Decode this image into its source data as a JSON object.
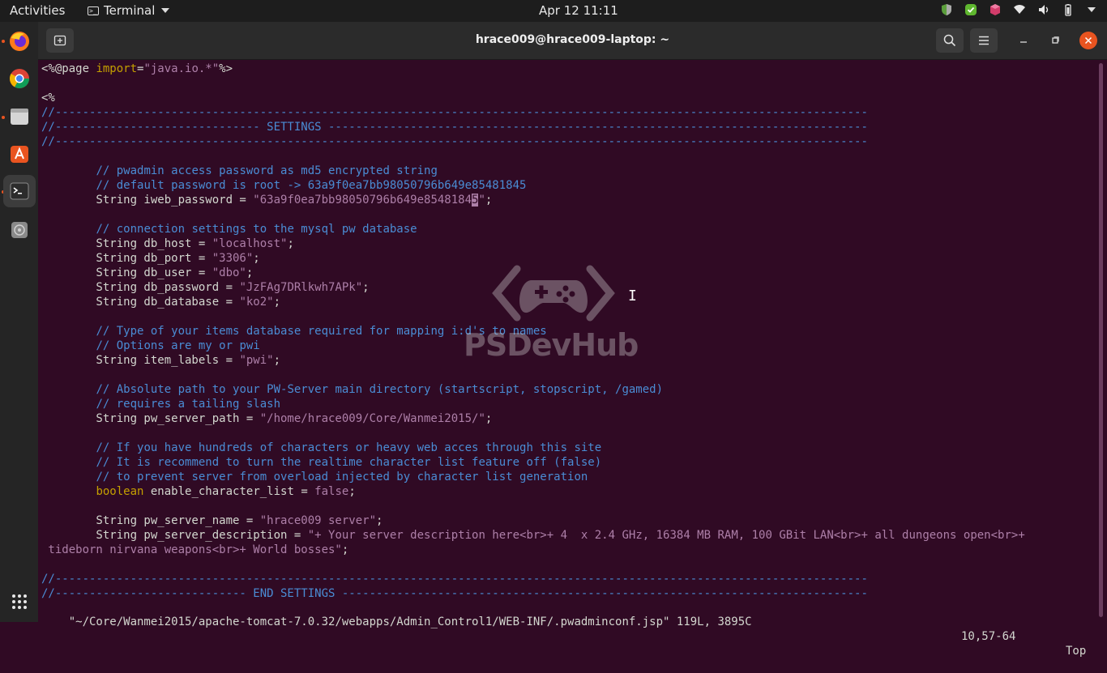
{
  "topbar": {
    "activities": "Activities",
    "app_name": "Terminal",
    "clock": "Apr 12  11:11"
  },
  "dock": {
    "items": [
      "firefox-icon",
      "chrome-icon",
      "files-icon",
      "software-icon",
      "terminal-icon",
      "disc-icon"
    ],
    "show_apps": "app-grid-icon"
  },
  "window": {
    "title": "hrace009@hrace009-laptop: ~"
  },
  "watermark": {
    "text": "PSDevHub"
  },
  "statusline": {
    "file": "\"~/Core/Wanmei2015/apache-tomcat-7.0.32/webapps/Admin_Control1/WEB-INF/.pwadminconf.jsp\" 119L, 3895C",
    "position": "10,57-64",
    "scroll": "Top"
  },
  "terminal": {
    "lines": [
      [
        [
          "t",
          "<%@page "
        ],
        [
          "k",
          "import"
        ],
        [
          "t",
          "="
        ],
        [
          "s",
          "\"java.io.*\""
        ],
        [
          "t",
          "%>"
        ]
      ],
      [],
      [
        [
          "t",
          "<%"
        ]
      ],
      [
        [
          "c",
          "//-----------------------------------------------------------------------------------------------------------------------"
        ]
      ],
      [
        [
          "c",
          "//------------------------------ SETTINGS -------------------------------------------------------------------------------"
        ]
      ],
      [
        [
          "c",
          "//-----------------------------------------------------------------------------------------------------------------------"
        ]
      ],
      [],
      [
        [
          "t",
          "        "
        ],
        [
          "c",
          "// pwadmin access password as md5 encrypted string"
        ]
      ],
      [
        [
          "t",
          "        "
        ],
        [
          "c",
          "// default password is root -> 63a9f0ea7bb98050796b649e85481845"
        ]
      ],
      [
        [
          "t",
          "        String iweb_password = "
        ],
        [
          "s",
          "\"63a9f0ea7bb98050796b649e8548184"
        ],
        [
          "cursor",
          "5"
        ],
        [
          "s",
          "\""
        ],
        [
          "t",
          ";"
        ]
      ],
      [],
      [
        [
          "t",
          "        "
        ],
        [
          "c",
          "// connection settings to the mysql pw database"
        ]
      ],
      [
        [
          "t",
          "        String db_host = "
        ],
        [
          "s",
          "\"localhost\""
        ],
        [
          "t",
          ";"
        ]
      ],
      [
        [
          "t",
          "        String db_port = "
        ],
        [
          "s",
          "\"3306\""
        ],
        [
          "t",
          ";"
        ]
      ],
      [
        [
          "t",
          "        String db_user = "
        ],
        [
          "s",
          "\"dbo\""
        ],
        [
          "t",
          ";"
        ]
      ],
      [
        [
          "t",
          "        String db_password = "
        ],
        [
          "s",
          "\"JzFAg7DRlkwh7APk\""
        ],
        [
          "t",
          ";"
        ]
      ],
      [
        [
          "t",
          "        String db_database = "
        ],
        [
          "s",
          "\"ko2\""
        ],
        [
          "t",
          ";"
        ]
      ],
      [],
      [
        [
          "t",
          "        "
        ],
        [
          "c",
          "// Type of your items database required for mapping i:d's to names"
        ]
      ],
      [
        [
          "t",
          "        "
        ],
        [
          "c",
          "// Options are my or pwi"
        ]
      ],
      [
        [
          "t",
          "        String item_labels = "
        ],
        [
          "s",
          "\"pwi\""
        ],
        [
          "t",
          ";"
        ]
      ],
      [],
      [
        [
          "t",
          "        "
        ],
        [
          "c",
          "// Absolute path to your PW-Server main directory (startscript, stopscript, /gamed)"
        ]
      ],
      [
        [
          "t",
          "        "
        ],
        [
          "c",
          "// requires a tailing slash"
        ]
      ],
      [
        [
          "t",
          "        String pw_server_path = "
        ],
        [
          "s",
          "\"/home/hrace009/Core/Wanmei2015/\""
        ],
        [
          "t",
          ";"
        ]
      ],
      [],
      [
        [
          "t",
          "        "
        ],
        [
          "c",
          "// If you have hundreds of characters or heavy web acces through this site"
        ]
      ],
      [
        [
          "t",
          "        "
        ],
        [
          "c",
          "// It is recommend to turn the realtime character list feature off (false)"
        ]
      ],
      [
        [
          "t",
          "        "
        ],
        [
          "c",
          "// to prevent server from overload injected by character list generation"
        ]
      ],
      [
        [
          "t",
          "        "
        ],
        [
          "k",
          "boolean"
        ],
        [
          "t",
          " enable_character_list = "
        ],
        [
          "s",
          "false"
        ],
        [
          "t",
          ";"
        ]
      ],
      [],
      [
        [
          "t",
          "        String pw_server_name = "
        ],
        [
          "s",
          "\"hrace009 server\""
        ],
        [
          "t",
          ";"
        ]
      ],
      [
        [
          "t",
          "        String pw_server_description = "
        ],
        [
          "s",
          "\"+ Your server description here<br>+ 4  x 2.4 GHz, 16384 MB RAM, 100 GBit LAN<br>+ all dungeons open<br>+"
        ]
      ],
      [
        [
          "s",
          " tideborn nirvana weapons<br>+ World bosses\""
        ],
        [
          "t",
          ";"
        ]
      ],
      [],
      [
        [
          "c",
          "//-----------------------------------------------------------------------------------------------------------------------"
        ]
      ],
      [
        [
          "c",
          "//---------------------------- END SETTINGS -----------------------------------------------------------------------------"
        ]
      ]
    ]
  }
}
